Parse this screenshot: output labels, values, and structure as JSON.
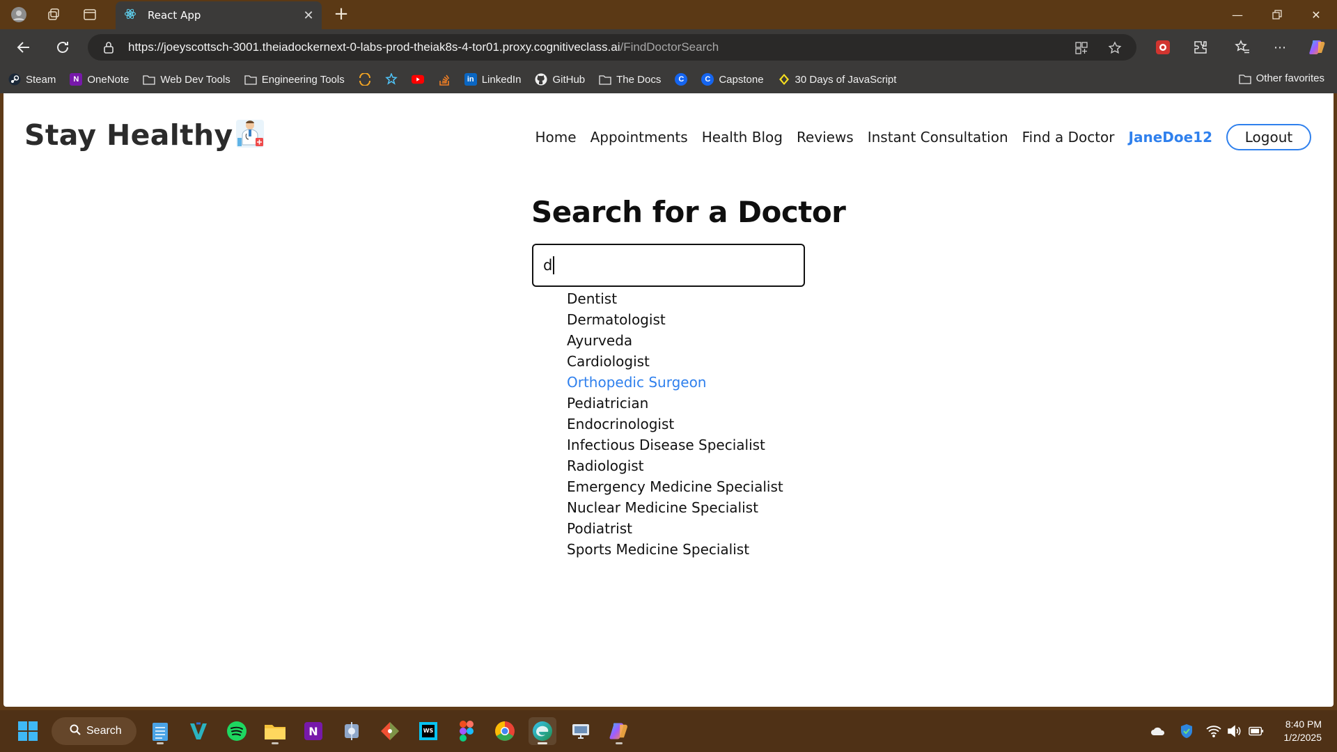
{
  "browser": {
    "tab_title": "React App",
    "url_host": "https://joeyscottsch-3001.theiadockernext-0-labs-prod-theiak8s-4-tor01.proxy.cognitiveclass.ai",
    "url_path": "/FindDoctorSearch",
    "bookmarks": [
      {
        "label": "Steam",
        "icon": "steam-icon"
      },
      {
        "label": "OneNote",
        "icon": "onenote-icon"
      },
      {
        "label": "Web Dev Tools",
        "icon": "folder-icon"
      },
      {
        "label": "Engineering Tools",
        "icon": "folder-icon"
      },
      {
        "label": "",
        "icon": "arc-icon"
      },
      {
        "label": "",
        "icon": "puzzle-star-icon"
      },
      {
        "label": "",
        "icon": "youtube-icon"
      },
      {
        "label": "",
        "icon": "stackoverflow-icon"
      },
      {
        "label": "LinkedIn",
        "icon": "linkedin-icon"
      },
      {
        "label": "GitHub",
        "icon": "github-icon"
      },
      {
        "label": "The Docs",
        "icon": "folder-icon"
      },
      {
        "label": "",
        "icon": "c-icon"
      },
      {
        "label": "Capstone",
        "icon": "c-icon"
      },
      {
        "label": "30 Days of JavaScript",
        "icon": "js-icon"
      }
    ],
    "other_favorites": "Other favorites"
  },
  "site": {
    "brand": "Stay Healthy",
    "nav": [
      "Home",
      "Appointments",
      "Health Blog",
      "Reviews",
      "Instant Consultation",
      "Find a Doctor"
    ],
    "user": "JaneDoe12",
    "logout": "Logout"
  },
  "search": {
    "title": "Search for a Doctor",
    "query": "d",
    "results": [
      "Dentist",
      "Dermatologist",
      "Ayurveda",
      "Cardiologist",
      "Orthopedic Surgeon",
      "Pediatrician",
      "Endocrinologist",
      "Infectious Disease Specialist",
      "Radiologist",
      "Emergency Medicine Specialist",
      "Nuclear Medicine Specialist",
      "Podiatrist",
      "Sports Medicine Specialist"
    ],
    "hovered_result": "Orthopedic Surgeon"
  },
  "taskbar": {
    "search_label": "Search",
    "time": "8:40 PM",
    "date": "1/2/2025"
  },
  "colors": {
    "accent": "#2f80ed",
    "chrome": "#3b3a39",
    "titlebar": "#5b3915",
    "taskbar": "#4f3116"
  }
}
